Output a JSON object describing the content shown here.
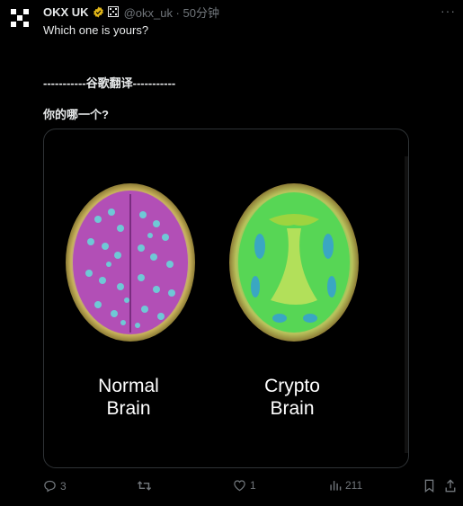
{
  "tweet": {
    "author_name": "OKX UK",
    "handle_time": "@okx_uk · 50分钟",
    "text": "Which one is yours?",
    "translate_divider": "-----------谷歌翻译-----------",
    "translated_text": "你的哪一个?",
    "media": {
      "labels": [
        "Normal\nBrain",
        "Crypto\nBrain"
      ]
    },
    "stats": {
      "replies": "3",
      "retweets": "",
      "likes": "1",
      "views": "211"
    }
  },
  "colors": {
    "background": "#000000",
    "text": "#e7e9ea",
    "muted": "#71767b",
    "verified": "#e2b719",
    "border": "#2f3336"
  },
  "icons": [
    "okx-logo-icon",
    "verified-badge-icon",
    "affiliate-icon",
    "more-icon",
    "reply-icon",
    "retweet-icon",
    "like-icon",
    "views-icon",
    "bookmark-icon",
    "share-icon"
  ]
}
